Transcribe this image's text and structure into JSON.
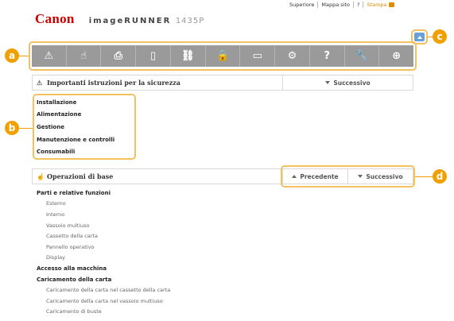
{
  "top_links": {
    "home": "Superiore",
    "sitemap": "Mappa sito",
    "help": "?",
    "print": "Stampa"
  },
  "brand": {
    "logo": "Canon",
    "model_name": "imageRUNNER",
    "model_number": "1435P"
  },
  "callouts": {
    "a": "a",
    "b": "b",
    "c": "c",
    "d": "d"
  },
  "accent_color": "#f0a000",
  "nav_icons": [
    {
      "name": "warning-icon",
      "glyph": "⚠"
    },
    {
      "name": "hand-icon",
      "glyph": "☝"
    },
    {
      "name": "printer-icon",
      "glyph": "⎙"
    },
    {
      "name": "device-icon",
      "glyph": "▯"
    },
    {
      "name": "network-icon",
      "glyph": "⛓"
    },
    {
      "name": "lock-icon",
      "glyph": "🔒"
    },
    {
      "name": "scanner-icon",
      "glyph": "▭"
    },
    {
      "name": "gear-icon",
      "glyph": "⚙"
    },
    {
      "name": "help-icon",
      "glyph": "?"
    },
    {
      "name": "wrench-icon",
      "glyph": "🔧"
    },
    {
      "name": "plus-icon",
      "glyph": "⊕"
    }
  ],
  "section_safety": {
    "title": "Importanti istruzioni per la sicurezza",
    "next": "Successivo",
    "items": [
      "Installazione",
      "Alimentazione",
      "Gestione",
      "Manutenzione e controlli",
      "Consumabili"
    ]
  },
  "section_basic": {
    "title": "Operazioni di base",
    "prev": "Precedente",
    "next": "Successivo",
    "tree": [
      {
        "level": 1,
        "label": "Parti e relative funzioni"
      },
      {
        "level": 2,
        "label": "Esterno"
      },
      {
        "level": 2,
        "label": "Interno"
      },
      {
        "level": 2,
        "label": "Vassoio multiuso"
      },
      {
        "level": 2,
        "label": "Cassetto della carta"
      },
      {
        "level": 2,
        "label": "Pannello operativo"
      },
      {
        "level": 2,
        "label": "Display"
      },
      {
        "level": 1,
        "label": "Accesso alla macchina"
      },
      {
        "level": 1,
        "label": "Caricamento della carta"
      },
      {
        "level": 2,
        "label": "Caricamento della carta nel cassetto della carta"
      },
      {
        "level": 2,
        "label": "Caricamento della carta nel vassoio multiuso"
      },
      {
        "level": 2,
        "label": "Caricamento di buste"
      }
    ]
  }
}
